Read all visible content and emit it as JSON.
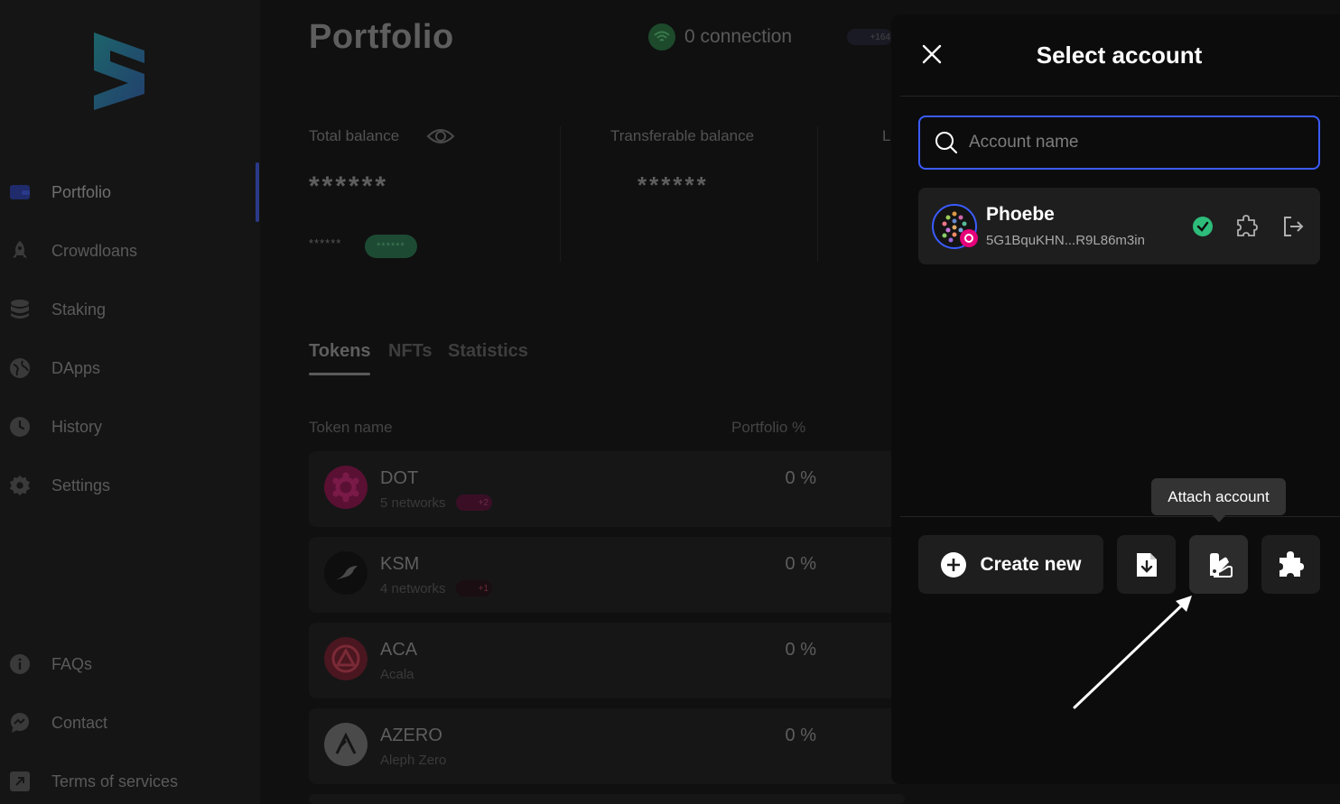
{
  "sidebar": {
    "items": [
      {
        "label": "Portfolio",
        "icon": "wallet-icon"
      },
      {
        "label": "Crowdloans",
        "icon": "rocket-icon"
      },
      {
        "label": "Staking",
        "icon": "database-icon"
      },
      {
        "label": "DApps",
        "icon": "globe-icon"
      },
      {
        "label": "History",
        "icon": "clock-icon"
      },
      {
        "label": "Settings",
        "icon": "gear-icon"
      }
    ],
    "bottom_items": [
      {
        "label": "FAQs",
        "icon": "info-icon"
      },
      {
        "label": "Contact",
        "icon": "chat-icon"
      },
      {
        "label": "Terms of services",
        "icon": "external-link-icon"
      }
    ]
  },
  "header": {
    "title": "Portfolio",
    "connection_text": "0 connection",
    "network_chip": "+164"
  },
  "balances": {
    "total_label": "Total balance",
    "total_value": "******",
    "transferable_label": "Transferable balance",
    "transferable_value": "******",
    "locked_label_partial": "L",
    "change_value": "******",
    "change_pill": "******"
  },
  "tabs": [
    "Tokens",
    "NFTs",
    "Statistics"
  ],
  "table": {
    "headers": {
      "name": "Token name",
      "portfolio": "Portfolio %"
    },
    "rows": [
      {
        "symbol": "DOT",
        "sub": "5 networks",
        "chip": "+2",
        "percent": "0 %"
      },
      {
        "symbol": "KSM",
        "sub": "4 networks",
        "chip": "+1",
        "percent": "0 %"
      },
      {
        "symbol": "ACA",
        "sub": "Acala",
        "percent": "0 %"
      },
      {
        "symbol": "AZERO",
        "sub": "Aleph Zero",
        "percent": "0 %"
      }
    ]
  },
  "drawer": {
    "title": "Select account",
    "search_placeholder": "Account name",
    "account": {
      "name": "Phoebe",
      "address": "5G1BquKHN...R9L86m3in"
    },
    "create_label": "Create new",
    "tooltip": "Attach account"
  },
  "colors": {
    "accent_blue": "#3a5cff",
    "success_green": "#2dbc7a",
    "polkadot_pink": "#e6007a"
  }
}
